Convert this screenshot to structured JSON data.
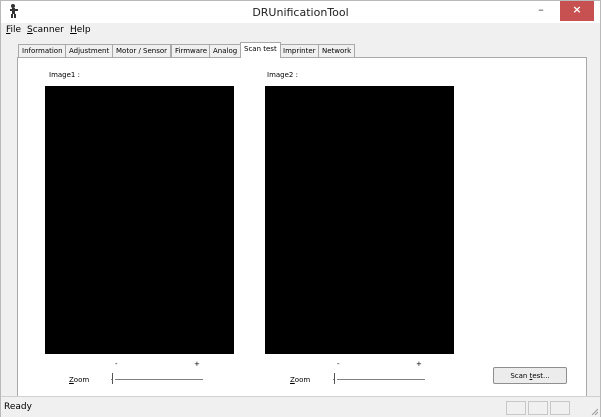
{
  "window": {
    "title": "DRUnificationTool",
    "controls": {
      "minimize": "–",
      "maximize": "□",
      "close": "×"
    }
  },
  "menubar": {
    "items": [
      {
        "label": "File",
        "accel": "F",
        "rest": "ile"
      },
      {
        "label": "Scanner",
        "accel": "S",
        "rest": "canner"
      },
      {
        "label": "Help",
        "accel": "H",
        "rest": "elp"
      }
    ]
  },
  "tabs": [
    {
      "label": "Information",
      "selected": false
    },
    {
      "label": "Adjustment",
      "selected": false
    },
    {
      "label": "Motor / Sensor",
      "selected": false
    },
    {
      "label": "Firmware",
      "selected": false
    },
    {
      "label": "Analog",
      "selected": false
    },
    {
      "label": "Scan test",
      "selected": true
    },
    {
      "label": "Imprinter",
      "selected": false
    },
    {
      "label": "Network",
      "selected": false
    }
  ],
  "scan_test": {
    "image1": {
      "label": "Image1 :"
    },
    "image2": {
      "label": "Image2 :"
    },
    "zoom1": {
      "label": "Zoom",
      "accel": "Z",
      "rest": "oom",
      "minus": "-",
      "plus": "+"
    },
    "zoom2": {
      "label": "Zoom",
      "accel": "Z",
      "rest": "oom",
      "minus": "-",
      "plus": "+"
    },
    "scan_button": {
      "label": "Scan test...",
      "pre": "Scan ",
      "accel": "t",
      "rest": "est..."
    }
  },
  "status": {
    "text": "Ready"
  },
  "colors": {
    "close_button": "#c75050",
    "image_background": "#000000"
  },
  "icons": {
    "app": "scanner-person-icon"
  }
}
